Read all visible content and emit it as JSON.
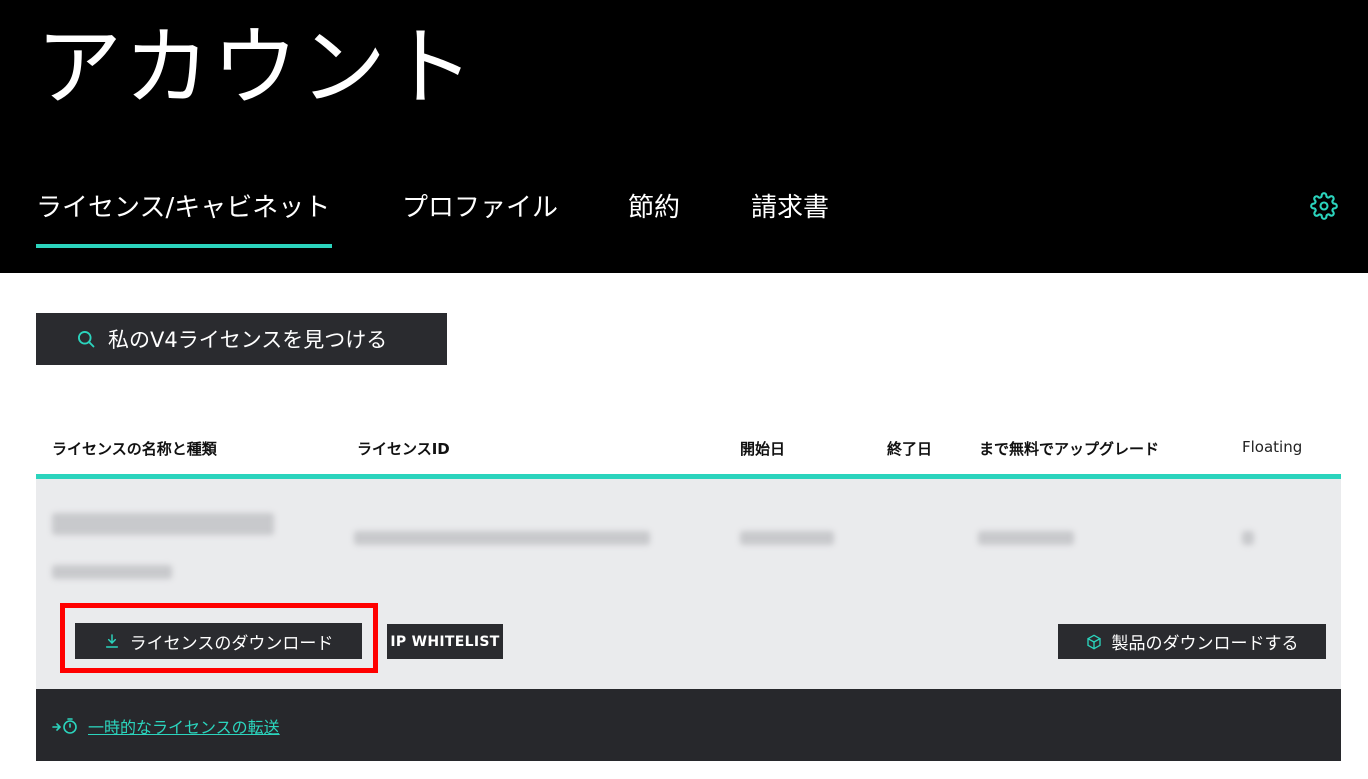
{
  "header": {
    "title": "アカウント",
    "tabs": [
      {
        "label": "ライセンス/キャビネット",
        "active": true
      },
      {
        "label": "プロファイル",
        "active": false
      },
      {
        "label": "節約",
        "active": false
      },
      {
        "label": "請求書",
        "active": false
      }
    ],
    "settings_icon": "gear-icon"
  },
  "search": {
    "label": "私のV4ライセンスを見つける",
    "icon": "search-icon"
  },
  "table": {
    "columns": [
      "ライセンスの名称と種類",
      "ライセンスID",
      "開始日",
      "終了日",
      "まで無料でアップグレード",
      "Floating"
    ]
  },
  "actions": {
    "download_license": "ライセンスのダウンロード",
    "ip_whitelist": "IP WHITELIST",
    "download_product": "製品のダウンロードする",
    "transfer_link": "一時的なライセンスの転送"
  },
  "colors": {
    "accent": "#2bd4bd",
    "header_bg": "#000000",
    "button_bg": "#2a2b2f",
    "row_bg": "#eaebed",
    "highlight": "#ff0000"
  }
}
